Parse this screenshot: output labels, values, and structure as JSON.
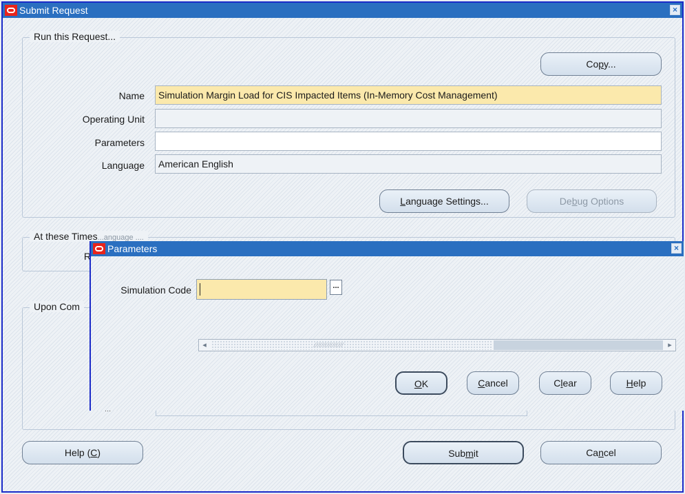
{
  "window": {
    "title": "Submit Request",
    "close_icon": "×"
  },
  "run_section": {
    "legend": "Run this Request...",
    "copy_button": {
      "pre": "Co",
      "key": "p",
      "post": "y..."
    },
    "name_label": "Name",
    "name_value": "Simulation Margin Load for CIS Impacted Items (In-Memory Cost Management)",
    "operating_unit_label": "Operating Unit",
    "operating_unit_value": "",
    "parameters_label": "Parameters",
    "parameters_value": "",
    "language_label": "Language",
    "language_value": "American English",
    "language_settings_button": {
      "pre": "",
      "key": "L",
      "post": "anguage Settings..."
    },
    "debug_options_button": {
      "pre": "De",
      "key": "b",
      "post": "ug Options"
    }
  },
  "times_section": {
    "legend": "At these Times",
    "partial_label": "R",
    "overlap_text": "...anguage ...."
  },
  "completion_section": {
    "legend": "Upon Com",
    "partial_label": "..."
  },
  "footer": {
    "help_button": {
      "pre": "Help (",
      "key": "C",
      "post": ")"
    },
    "submit_button": {
      "pre": "Sub",
      "key": "m",
      "post": "it"
    },
    "cancel_button": {
      "pre": "Ca",
      "key": "n",
      "post": "cel"
    }
  },
  "parameters_dialog": {
    "title": "Parameters",
    "close_icon": "×",
    "simulation_code_label": "Simulation Code",
    "simulation_code_value": "",
    "lov_icon": "...",
    "ok_button": {
      "pre": "",
      "key": "O",
      "post": "K"
    },
    "cancel_button": {
      "pre": "",
      "key": "C",
      "post": "ancel"
    },
    "clear_button": {
      "pre": "C",
      "key": "l",
      "post": "ear"
    },
    "help_button": {
      "pre": "",
      "key": "H",
      "post": "elp"
    },
    "scroll_left_icon": "◂",
    "scroll_right_icon": "▸",
    "scroll_grip": "⁄⁄⁄⁄⁄⁄⁄⁄⁄⁄⁄⁄⁄⁄⁄⁄"
  }
}
